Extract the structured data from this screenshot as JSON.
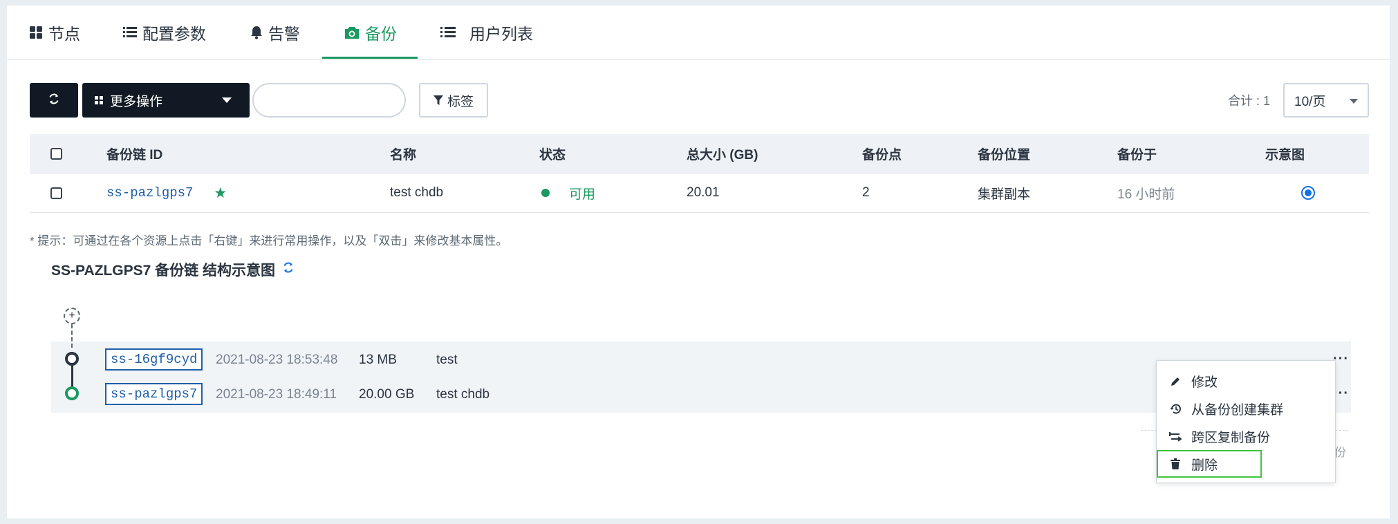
{
  "tabs": [
    {
      "label": "节点",
      "icon": "grid-icon"
    },
    {
      "label": "配置参数",
      "icon": "list-icon"
    },
    {
      "label": "告警",
      "icon": "bell-icon"
    },
    {
      "label": "备份",
      "icon": "camera-icon",
      "active": true
    },
    {
      "label": "用户列表",
      "icon": "list-icon"
    }
  ],
  "toolbar": {
    "more_actions_label": "更多操作",
    "search_placeholder": "",
    "tag_label": "标签",
    "total_label": "合计 : 1",
    "per_page": "10/页"
  },
  "table": {
    "headers": [
      "备份链 ID",
      "名称",
      "状态",
      "总大小 (GB)",
      "备份点",
      "备份位置",
      "备份于",
      "示意图"
    ],
    "rows": [
      {
        "id": "ss-pazlgps7",
        "name": "test chdb",
        "status": "可用",
        "total_size": "20.01",
        "points": "2",
        "location": "集群副本",
        "backup_at": "16 小时前"
      }
    ]
  },
  "tip": "* 提示：可通过在各个资源上点击「右键」来进行常用操作，以及「双击」来修改基本属性。",
  "diagram": {
    "title": "SS-PAZLGPS7 备份链 结构示意图",
    "plus": "+",
    "nodes": [
      {
        "id": "ss-16gf9cyd",
        "time": "2021-08-23 18:53:48",
        "size": "13 MB",
        "name": "test"
      },
      {
        "id": "ss-pazlgps7",
        "time": "2021-08-23 18:49:11",
        "size": "20.00 GB",
        "name": "test chdb"
      }
    ],
    "dots": "···",
    "side_text": "份"
  },
  "context_menu": {
    "items": [
      {
        "label": "修改",
        "icon": "pencil-icon"
      },
      {
        "label": "从备份创建集群",
        "icon": "history-icon"
      },
      {
        "label": "跨区复制备份",
        "icon": "transfer-icon"
      },
      {
        "label": "删除",
        "icon": "trash-icon"
      }
    ]
  },
  "colors": {
    "accent": "#1a9960",
    "link": "#1f5fa8",
    "dark_button": "#111a24",
    "highlight_outline": "#3ec43e"
  }
}
